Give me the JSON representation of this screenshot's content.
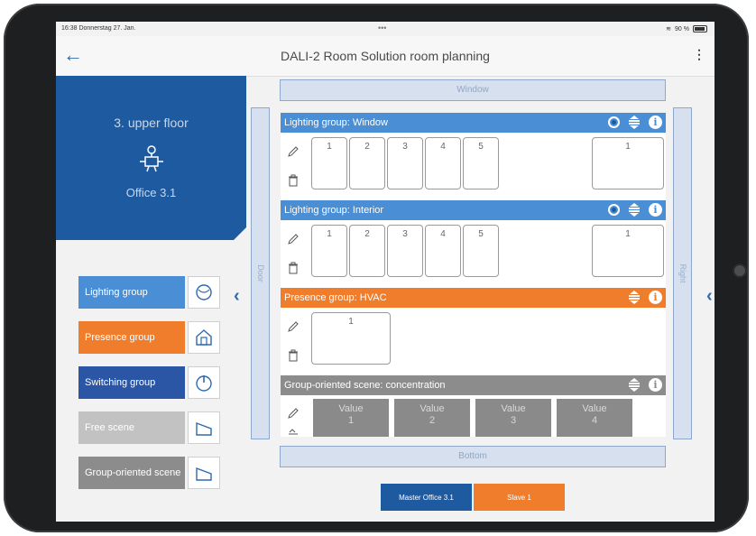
{
  "status": {
    "time_date": "16:38  Donnerstag 27. Jan.",
    "dots": "•••",
    "battery": "90 %"
  },
  "nav": {
    "back": "←",
    "title": "DALI-2 Room Solution room planning",
    "menu": "⋮"
  },
  "room": {
    "floor": "3. upper floor",
    "name": "Office 3.1"
  },
  "legend": [
    {
      "label": "Lighting group",
      "color": "#4a8fd6",
      "icon": "lamp-icon"
    },
    {
      "label": "Presence group",
      "color": "#f07d2c",
      "icon": "house-icon"
    },
    {
      "label": "Switching group",
      "color": "#2b56a6",
      "icon": "power-icon"
    },
    {
      "label": "Free scene",
      "color": "#c2c2c2",
      "icon": "scene-icon"
    },
    {
      "label": "Group-oriented scene",
      "color": "#8c8c8c",
      "icon": "scene-icon"
    }
  ],
  "walls": {
    "top": "Window",
    "left": "Door",
    "right": "Right",
    "bottom": "Bottom"
  },
  "groups": [
    {
      "title": "Lighting group: Window",
      "color": "#4a8fd6",
      "tiles": [
        "1",
        "2",
        "3",
        "4",
        "5"
      ],
      "sensor": "1"
    },
    {
      "title": "Lighting group: Interior",
      "color": "#4a8fd6",
      "tiles": [
        "1",
        "2",
        "3",
        "4",
        "5"
      ],
      "sensor": "1"
    },
    {
      "title": "Presence group: HVAC",
      "color": "#f07d2c",
      "tiles": [
        "1"
      ]
    },
    {
      "title": "Group-oriented scene: concentration",
      "color": "#8c8c8c",
      "values": [
        {
          "label": "Value",
          "num": "1"
        },
        {
          "label": "Value",
          "num": "2"
        },
        {
          "label": "Value",
          "num": "3"
        },
        {
          "label": "Value",
          "num": "4"
        }
      ]
    }
  ],
  "footer": {
    "master": "Master Office 3.1",
    "slave": "Slave 1",
    "master_color": "#1e5aa0",
    "slave_color": "#f07d2c"
  }
}
